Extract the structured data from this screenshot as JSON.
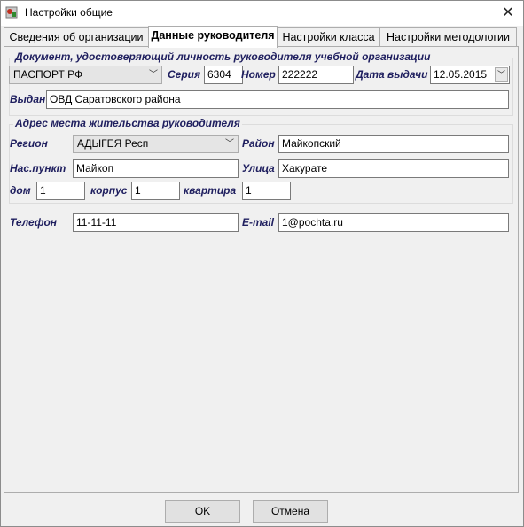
{
  "window": {
    "title": "Настройки общие",
    "close_glyph": "✕"
  },
  "tabs": [
    {
      "label": "Сведения об организации"
    },
    {
      "label": "Данные руководителя"
    },
    {
      "label": "Настройки класса"
    },
    {
      "label": "Настройки методологии"
    }
  ],
  "document": {
    "group_title": "Документ, удостоверяющий личность руководителя учебной организации",
    "doc_type": "ПАСПОРТ РФ",
    "series_label": "Серия",
    "series_value": "6304",
    "number_label": "Номер",
    "number_value": "222222",
    "issue_date_label": "Дата выдачи",
    "issue_date_value": "12.05.2015",
    "issued_by_label": "Выдан",
    "issued_by_value": "ОВД Саратовского района"
  },
  "address": {
    "group_title": "Адрес места жительства руководителя",
    "region_label": "Регион",
    "region_value": "АДЫГЕЯ Респ",
    "district_label": "Район",
    "district_value": "Майкопский",
    "locality_label": "Нас.пункт",
    "locality_value": "Майкоп",
    "street_label": "Улица",
    "street_value": "Хакурате",
    "house_label": "дом",
    "house_value": "1",
    "building_label": "корпус",
    "building_value": "1",
    "apartment_label": "квартира",
    "apartment_value": "1"
  },
  "contacts": {
    "phone_label": "Телефон",
    "phone_value": "11-11-11",
    "email_label": "E-mail",
    "email_value": "1@pochta.ru"
  },
  "buttons": {
    "ok_label": "OK",
    "cancel_label": "Отмена"
  },
  "icons": {
    "app": "app-icon",
    "dropdown": "chevron-down-icon",
    "close": "close-icon"
  }
}
